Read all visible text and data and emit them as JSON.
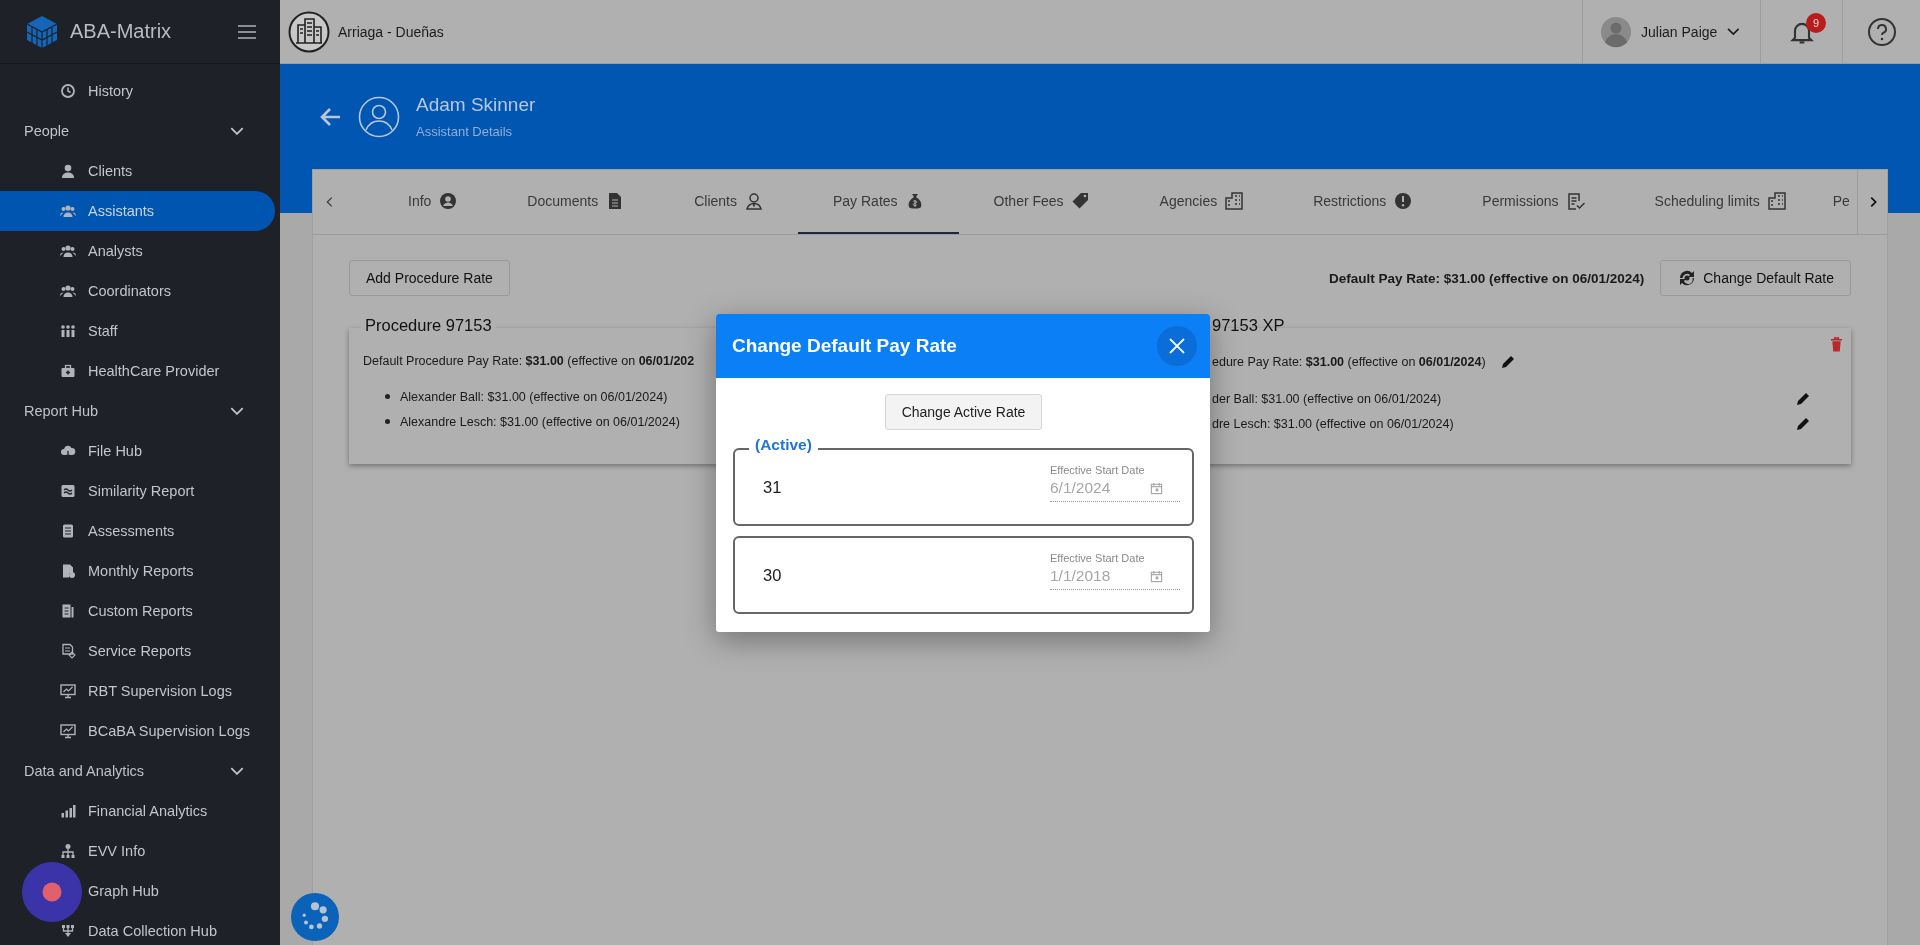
{
  "app": {
    "name": "ABA-Matrix"
  },
  "sidebar": {
    "items": [
      {
        "kind": "link",
        "label": "History",
        "selected": false
      },
      {
        "kind": "group",
        "label": "People",
        "expanded": true,
        "children": [
          {
            "kind": "link",
            "label": "Clients",
            "selected": false
          },
          {
            "kind": "link",
            "label": "Assistants",
            "selected": true
          },
          {
            "kind": "link",
            "label": "Analysts",
            "selected": false
          },
          {
            "kind": "link",
            "label": "Coordinators",
            "selected": false
          },
          {
            "kind": "link",
            "label": "Staff",
            "selected": false
          },
          {
            "kind": "link",
            "label": "HealthCare Provider",
            "selected": false
          }
        ]
      },
      {
        "kind": "group",
        "label": "Report Hub",
        "expanded": true,
        "children": [
          {
            "kind": "link",
            "label": "File Hub",
            "selected": false
          },
          {
            "kind": "link",
            "label": "Similarity Report",
            "selected": false
          },
          {
            "kind": "link",
            "label": "Assessments",
            "selected": false
          },
          {
            "kind": "link",
            "label": "Monthly Reports",
            "selected": false
          },
          {
            "kind": "link",
            "label": "Custom Reports",
            "selected": false
          },
          {
            "kind": "link",
            "label": "Service Reports",
            "selected": false
          },
          {
            "kind": "link",
            "label": "RBT Supervision Logs",
            "selected": false
          },
          {
            "kind": "link",
            "label": "BCaBA Supervision Logs",
            "selected": false
          }
        ]
      },
      {
        "kind": "group",
        "label": "Data and Analytics",
        "expanded": true,
        "children": [
          {
            "kind": "link",
            "label": "Financial Analytics",
            "selected": false
          },
          {
            "kind": "link",
            "label": "EVV Info",
            "selected": false
          },
          {
            "kind": "link",
            "label": "Graph Hub",
            "selected": false
          },
          {
            "kind": "link",
            "label": "Data Collection Hub",
            "selected": false
          }
        ]
      }
    ]
  },
  "topbar": {
    "company": "Arriaga - Dueñas",
    "user": "Julian Paige",
    "notification_count": "9"
  },
  "header": {
    "name": "Adam Skinner",
    "subtitle": "Assistant Details"
  },
  "tabs": [
    {
      "label": "Info",
      "selected": false
    },
    {
      "label": "Documents",
      "selected": false
    },
    {
      "label": "Clients",
      "selected": false
    },
    {
      "label": "Pay Rates",
      "selected": true
    },
    {
      "label": "Other Fees",
      "selected": false
    },
    {
      "label": "Agencies",
      "selected": false
    },
    {
      "label": "Restrictions",
      "selected": false
    },
    {
      "label": "Permissions",
      "selected": false
    },
    {
      "label": "Scheduling limits",
      "selected": false
    },
    {
      "label": "Pe",
      "selected": false
    }
  ],
  "pay_rates": {
    "add_button": "Add Procedure Rate",
    "default_rate": "Default Pay Rate: $31.00 (effective on 06/01/2024)",
    "change_button": "Change Default Rate",
    "procedures": [
      {
        "title": "Procedure 97153",
        "default": "Default Procedure Pay Rate: **$31.00** (effective on **06/01/202**",
        "assistants": [
          "Alexander Ball: $31.00 (effective on 06/01/2024)",
          "Alexandre Lesch: $31.00 (effective on 06/01/2024)"
        ]
      },
      {
        "title": "97153 XP",
        "default": "edure Pay Rate: **$31.00** (effective on **06/01/2024**)",
        "assistants": [
          "der Ball: $31.00 (effective on 06/01/2024)",
          "dre Lesch: $31.00 (effective on 06/01/2024)"
        ]
      }
    ]
  },
  "dialog": {
    "title": "Change Default Pay Rate",
    "action": "Change Active Rate",
    "active_label": "(Active)",
    "rates": [
      {
        "value": "31",
        "date_label": "Effective Start Date",
        "date": "6/1/2024",
        "active": true
      },
      {
        "value": "30",
        "date_label": "Effective Start Date",
        "date": "1/1/2018",
        "active": false
      }
    ]
  }
}
